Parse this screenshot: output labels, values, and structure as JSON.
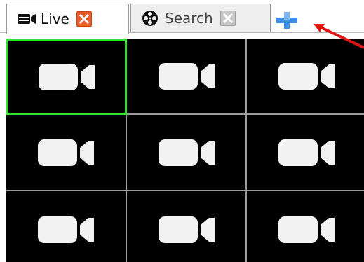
{
  "tabs": [
    {
      "label": "Live",
      "icon": "camera-icon",
      "close_icon": "close-icon",
      "active": true,
      "close_color": "#ec5d2c"
    },
    {
      "label": "Search",
      "icon": "film-reel-icon",
      "close_icon": "close-icon",
      "active": false,
      "close_color": "#c8c8c8"
    }
  ],
  "add_tab": {
    "icon": "plus-icon",
    "color": "#3d8ee8"
  },
  "annotation": {
    "icon": "arrow-icon",
    "color": "#e01515"
  },
  "video_grid": {
    "rows": 3,
    "columns": 3,
    "selected_cell": 1,
    "selected_color": "#2ee52e",
    "cell_icon": "video-camera-icon"
  }
}
